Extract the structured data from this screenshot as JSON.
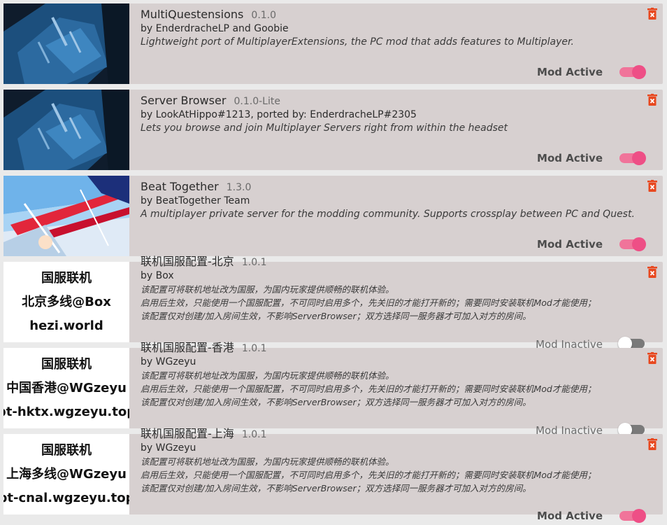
{
  "colors": {
    "accent": "#ee4f86",
    "card_bg": "#d7d0d0",
    "delete_red": "#e8481f"
  },
  "mods": [
    {
      "name": "MultiQuestensions",
      "version": "0.1.0",
      "author": "by EnderdracheLP and Goobie",
      "description": [
        "Lightweight port of MultiplayerExtensions, the PC mod that adds features to Multiplayer."
      ],
      "status": "Mod Active",
      "active": true,
      "icon": "trash-icon"
    },
    {
      "name": "Server Browser",
      "version": "0.1.0-Lite",
      "author": "by LookAtHippo#1213, ported by: EnderdracheLP#2305",
      "description": [
        "Lets you browse and join Multiplayer Servers right from within the headset"
      ],
      "status": "Mod Active",
      "active": true,
      "icon": "trash-icon"
    },
    {
      "name": "Beat Together",
      "version": "1.3.0",
      "author": "by BeatTogether Team",
      "description": [
        "A multiplayer private server for the modding community. Supports crossplay between PC and Quest."
      ],
      "status": "Mod Active",
      "active": true,
      "icon": "trash-icon"
    },
    {
      "name": "联机国服配置-北京",
      "version": "1.0.1",
      "author": "by Box",
      "description": [
        "该配置可将联机地址改为国服，为国内玩家提供顺畅的联机体验。",
        "启用后生效，只能使用一个国服配置，不可同时启用多个，先关旧的才能打开新的；需要同时安装联机Mod才能使用；",
        "该配置仅对创建/加入房间生效，不影响ServerBrowser；双方选择同一服务器才可加入对方的房间。"
      ],
      "thumb_lines": [
        "国服联机",
        "北京多线@Box",
        "hezi.world"
      ],
      "status": "Mod Inactive",
      "active": false,
      "icon": "trash-icon"
    },
    {
      "name": "联机国服配置-香港",
      "version": "1.0.1",
      "author": "by WGzeyu",
      "description": [
        "该配置可将联机地址改为国服，为国内玩家提供顺畅的联机体验。",
        "启用后生效，只能使用一个国服配置，不可同时启用多个，先关旧的才能打开新的；需要同时安装联机Mod才能使用；",
        "该配置仅对创建/加入房间生效，不影响ServerBrowser；双方选择同一服务器才可加入对方的房间。"
      ],
      "thumb_lines": [
        "国服联机",
        "中国香港@WGzeyu",
        "bt-hktx.wgzeyu.top"
      ],
      "status": "Mod Inactive",
      "active": false,
      "icon": "trash-icon"
    },
    {
      "name": "联机国服配置-上海",
      "version": "1.0.1",
      "author": "by WGzeyu",
      "description": [
        "该配置可将联机地址改为国服，为国内玩家提供顺畅的联机体验。",
        "启用后生效，只能使用一个国服配置，不可同时启用多个，先关旧的才能打开新的；需要同时安装联机Mod才能使用；",
        "该配置仅对创建/加入房间生效，不影响ServerBrowser；双方选择同一服务器才可加入对方的房间。"
      ],
      "thumb_lines": [
        "国服联机",
        "上海多线@WGzeyu",
        "bt-cnal.wgzeyu.top"
      ],
      "status": "Mod Active",
      "active": true,
      "icon": "trash-icon"
    }
  ]
}
